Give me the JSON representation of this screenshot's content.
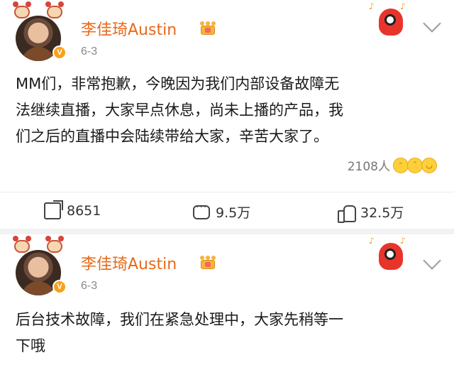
{
  "posts": [
    {
      "author": "李佳琦Austin",
      "date": "6-3",
      "content_lines": [
        "MM们，非常抱歉，今晚因为我们内部设备故障无",
        "法继续直播，大家早点休息，尚未上播的产品，我",
        "们之后的直播中会陆续带给大家，辛苦大家了。"
      ],
      "like_reactions": {
        "count": "2108人",
        "emojis": [
          "laugh-emoji",
          "sad-emoji",
          "grin-emoji"
        ]
      },
      "actions": {
        "share": "8651",
        "comment": "9.5万",
        "like": "32.5万"
      }
    },
    {
      "author": "李佳琦Austin",
      "date": "6-3",
      "content_lines": [
        "后台技术故障，我们在紧急处理中，大家先稍等一",
        "下哦"
      ]
    }
  ],
  "colors": {
    "author": "#e86a1a",
    "date": "#8a8a8a",
    "verified_badge": "#f7a21b",
    "divider": "#f2f2f2"
  },
  "icons": [
    "ox-decoration-icon",
    "verified-badge-icon",
    "crown-badge-icon",
    "mascot-sticker-icon",
    "chevron-down-icon",
    "share-icon",
    "comment-icon",
    "like-icon"
  ]
}
